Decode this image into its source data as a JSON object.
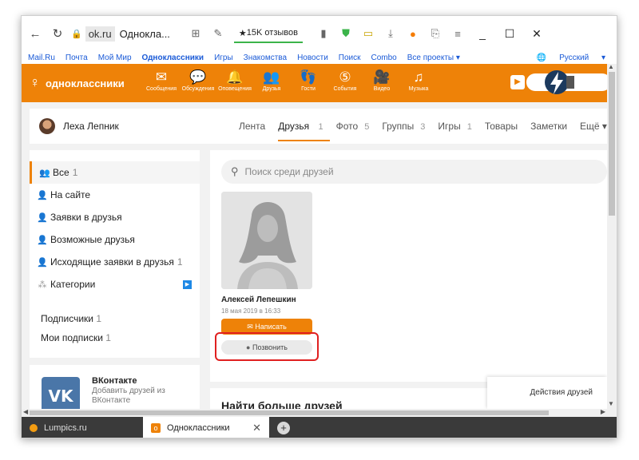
{
  "browser": {
    "url_host": "ok.ru",
    "tab_title_short": "Однокла...",
    "reviews_label": "15K отзывов"
  },
  "mailbar": {
    "items": [
      "Mail.Ru",
      "Почта",
      "Мой Мир",
      "Одноклассники",
      "Игры",
      "Знакомства",
      "Новости",
      "Поиск",
      "Combo",
      "Все проекты ▾"
    ],
    "language": "Русский"
  },
  "ok_header": {
    "logo_text": "одноклассники",
    "nav": [
      {
        "label": "Сообщения",
        "icon": "envelope-icon",
        "glyph": "✉"
      },
      {
        "label": "Обсуждения",
        "icon": "chat-icon",
        "glyph": "💬"
      },
      {
        "label": "Оповещения",
        "icon": "bell-icon",
        "glyph": "🔔"
      },
      {
        "label": "Друзья",
        "icon": "friends-icon",
        "glyph": "👥"
      },
      {
        "label": "Гости",
        "icon": "footprints-icon",
        "glyph": "👣"
      },
      {
        "label": "События",
        "icon": "events-icon",
        "glyph": "⑤"
      },
      {
        "label": "Видео",
        "icon": "video-icon",
        "glyph": "🎥"
      },
      {
        "label": "Музыка",
        "icon": "music-icon",
        "glyph": "♫"
      }
    ]
  },
  "profile": {
    "name": "Леха Лепник",
    "tabs": [
      {
        "label": "Лента",
        "count": ""
      },
      {
        "label": "Друзья",
        "count": "1"
      },
      {
        "label": "Фото",
        "count": "5"
      },
      {
        "label": "Группы",
        "count": "3"
      },
      {
        "label": "Игры",
        "count": "1"
      },
      {
        "label": "Товары",
        "count": ""
      },
      {
        "label": "Заметки",
        "count": ""
      },
      {
        "label": "Ещё ▾",
        "count": ""
      }
    ]
  },
  "sidebar": {
    "items": [
      {
        "label": "Все",
        "count": "1"
      },
      {
        "label": "На сайте",
        "count": ""
      },
      {
        "label": "Заявки в друзья",
        "count": ""
      },
      {
        "label": "Возможные друзья",
        "count": ""
      },
      {
        "label": "Исходящие заявки в друзья",
        "count": "1"
      },
      {
        "label": "Категории",
        "count": ""
      }
    ],
    "followers": {
      "label": "Подписчики",
      "count": "1"
    },
    "subscriptions": {
      "label": "Мои подписки",
      "count": "1"
    }
  },
  "vk_card": {
    "logo": "VK",
    "title": "ВКонтакте",
    "subtitle": "Добавить друзей из ВКонтакте"
  },
  "main": {
    "search_placeholder": "Поиск среди друзей",
    "friend": {
      "name": "Алексей Лепешкин",
      "date": "18 мая 2019 в 16:33",
      "write_label": "Написать",
      "call_label": "Позвонить"
    },
    "more_friends_title": "Найти больше друзей",
    "actions_label": "Действия друзей"
  },
  "tabs": {
    "lumpics": "Lumpics.ru",
    "ok": "Одноклассники"
  },
  "colors": {
    "ok_orange": "#ee8208",
    "highlight_red": "#e02020",
    "vk_blue": "#4a76a8"
  }
}
